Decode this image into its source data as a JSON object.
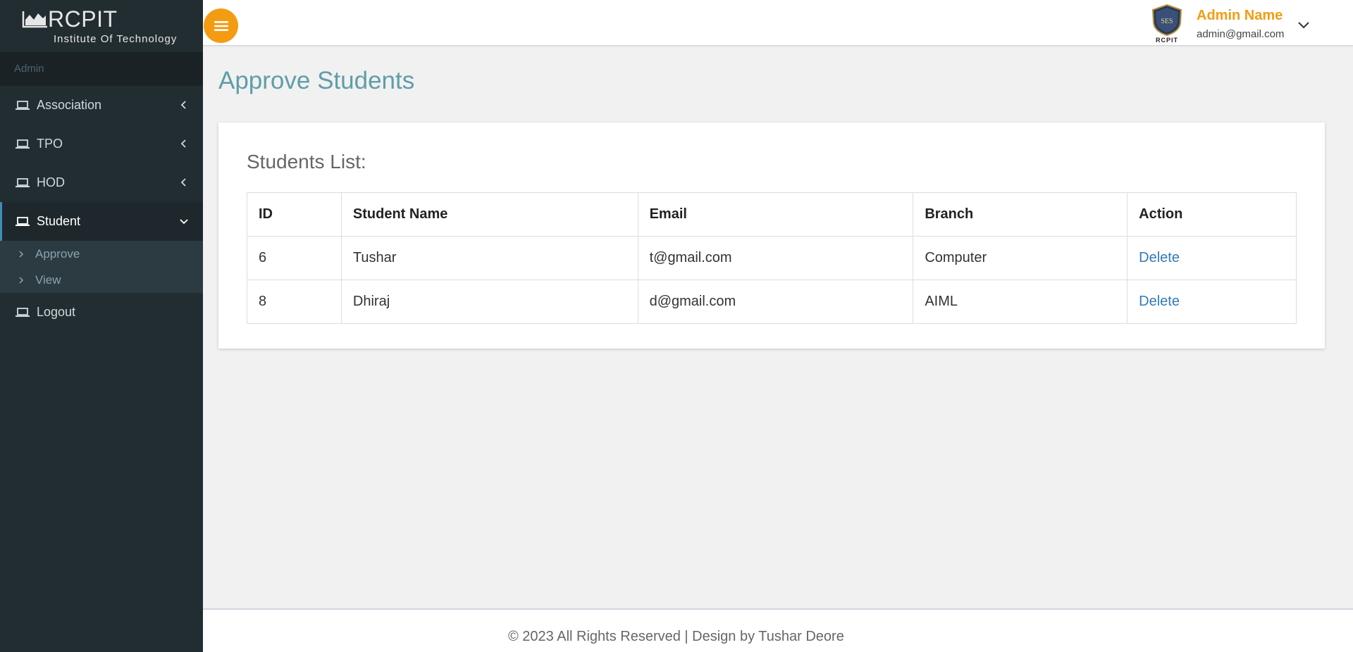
{
  "brand": {
    "name": "RCPIT",
    "subtitle": "Institute Of Technology"
  },
  "sidebar": {
    "role": "Admin",
    "items": [
      {
        "label": "Association",
        "expanded": false
      },
      {
        "label": "TPO",
        "expanded": false
      },
      {
        "label": "HOD",
        "expanded": false
      },
      {
        "label": "Student",
        "expanded": true,
        "children": [
          {
            "label": "Approve"
          },
          {
            "label": "View"
          }
        ]
      },
      {
        "label": "Logout"
      }
    ]
  },
  "header": {
    "user_name": "Admin Name",
    "user_email": "admin@gmail.com",
    "logo_text": "RCPIT",
    "logo_badge": "SES"
  },
  "main": {
    "title": "Approve Students",
    "card_title": "Students List:",
    "table": {
      "columns": [
        "ID",
        "Student Name",
        "Email",
        "Branch",
        "Action"
      ],
      "rows": [
        [
          "6",
          "Tushar",
          "t@gmail.com",
          "Computer",
          "Delete"
        ],
        [
          "8",
          "Dhiraj",
          "d@gmail.com",
          "AIML",
          "Delete"
        ]
      ]
    }
  },
  "footer": {
    "text": "© 2023 All Rights Reserved | Design by Tushar Deore"
  },
  "colors": {
    "sidebar": "#222d32",
    "accent": "#f39c12",
    "title": "#5f9ea8",
    "link": "#337ab7",
    "active_border": "#3c8dbc"
  }
}
